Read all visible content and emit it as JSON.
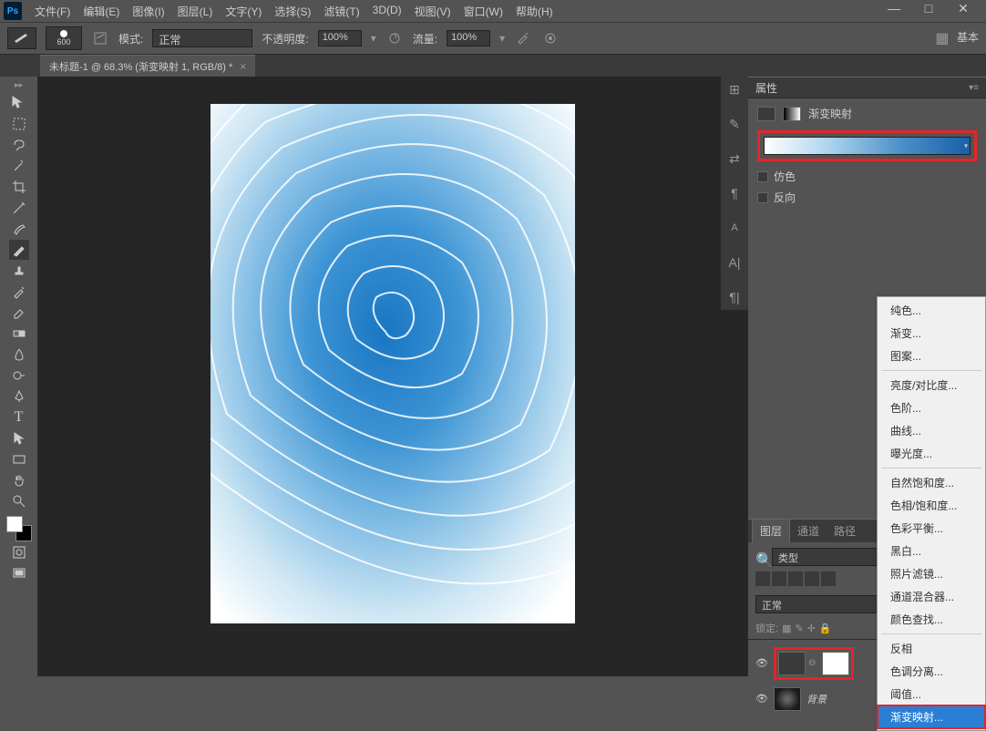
{
  "app": {
    "name": "Ps"
  },
  "menu": {
    "file": "文件(F)",
    "edit": "编辑(E)",
    "image": "图像(I)",
    "layer": "图层(L)",
    "type": "文字(Y)",
    "select": "选择(S)",
    "filter": "滤镜(T)",
    "threeD": "3D(D)",
    "view": "视图(V)",
    "window": "窗口(W)",
    "help": "帮助(H)"
  },
  "options": {
    "brush_size": "600",
    "mode_label": "模式:",
    "mode_value": "正常",
    "opacity_label": "不透明度:",
    "opacity_value": "100%",
    "flow_label": "流量:",
    "flow_value": "100%",
    "basic_label": "基本"
  },
  "document": {
    "tab_title": "未标题-1 @ 68.3% (渐变映射 1, RGB/8) *"
  },
  "properties": {
    "panel_title": "属性",
    "type_label": "渐变映射",
    "dither": "仿色",
    "reverse": "反向"
  },
  "layers": {
    "tabs": {
      "layers": "图层",
      "channels": "通道",
      "paths": "路径"
    },
    "filter_label": "类型",
    "blend_mode": "正常",
    "lock_label": "锁定:",
    "items": [
      {
        "name": "",
        "adjustment": true
      },
      {
        "name": "背景"
      }
    ]
  },
  "context_menu": {
    "items": [
      "纯色...",
      "渐变...",
      "图案...",
      "亮度/对比度...",
      "色阶...",
      "曲线...",
      "曝光度...",
      "自然饱和度...",
      "色相/饱和度...",
      "色彩平衡...",
      "黑白...",
      "照片滤镜...",
      "通道混合器...",
      "颜色查找...",
      "反相",
      "色调分离...",
      "阈值...",
      "渐变映射..."
    ]
  },
  "window_controls": {
    "min": "—",
    "max": "□",
    "close": "✕"
  }
}
